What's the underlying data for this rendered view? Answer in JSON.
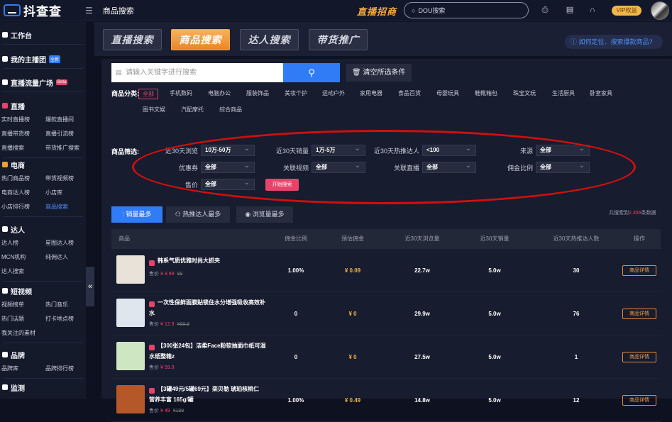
{
  "app": {
    "logo_text": "抖查查",
    "page_title": "商品搜索",
    "promo": "直播招商",
    "search_placeholder": "DOU搜索",
    "vip": "VIP权益"
  },
  "sidebar": [
    {
      "title": "工作台",
      "icon": "grid-icon",
      "items": []
    },
    {
      "title": "我的主播团",
      "badge": "全新",
      "icon": "team-icon",
      "items": []
    },
    {
      "title": "直播流量广场",
      "badge": "Beta",
      "icon": "broadcast-icon",
      "items": []
    },
    {
      "title": "直播",
      "icon": "chart-icon",
      "items": [
        "实时直播榜",
        "爆款直播间",
        "直播带货榜",
        "直播引流榜",
        "直播搜索",
        "带货推广搜索"
      ]
    },
    {
      "title": "电商",
      "icon": "shop-icon",
      "items": [
        "热门商品榜",
        "带货视频榜",
        "电商达人榜",
        "小店库",
        "小店排行榜",
        "商品搜索"
      ]
    },
    {
      "title": "达人",
      "icon": "person-icon",
      "items": [
        "达人榜",
        "星图达人榜",
        "MCN机构",
        "纯佣达人",
        "达人搜索"
      ]
    },
    {
      "title": "短视频",
      "icon": "bulb-icon",
      "items": [
        "视频榜单",
        "热门音乐",
        "热门话题",
        "打卡地点榜",
        "我关注的素材"
      ]
    },
    {
      "title": "品牌",
      "icon": "brand-icon",
      "items": [
        "品牌库",
        "品牌排行榜"
      ]
    },
    {
      "title": "监测",
      "icon": "monitor-icon",
      "items": []
    }
  ],
  "active_sidebar_item": "商品搜索",
  "tabs": [
    "直播搜索",
    "商品搜索",
    "达人搜索",
    "带货推广"
  ],
  "help_link": "如何定位、搜索爆款商品?",
  "keyword_placeholder": "请输入关键字进行搜索",
  "clear_label": "清空所选条件",
  "category_label": "商品分类:",
  "categories": [
    "全部",
    "手机数码",
    "电脑办公",
    "服装饰品",
    "美妆个护",
    "运动户外",
    "家用电器",
    "食品百货",
    "母婴玩具",
    "鞋靴箱包",
    "珠宝文玩",
    "生活厨具",
    "卧室家具",
    "图书文娱",
    "汽配摩托",
    "综合商品"
  ],
  "filter_label": "商品筛选:",
  "filters": [
    {
      "label": "近30天浏览",
      "value": "10万-50万"
    },
    {
      "label": "近30天销量",
      "value": "1万-5万"
    },
    {
      "label": "近30天热推达人",
      "value": "<100"
    },
    {
      "label": "来源",
      "value": "全部"
    },
    {
      "label": "优惠券",
      "value": "全部"
    },
    {
      "label": "关联视频",
      "value": "全部"
    },
    {
      "label": "关联直播",
      "value": "全部"
    },
    {
      "label": "佣金比例",
      "value": "全部"
    },
    {
      "label": "售价",
      "value": "全部"
    }
  ],
  "start_button": "开始搜索",
  "sort_buttons": [
    "销量最多",
    "热推达人最多",
    "浏览量最多"
  ],
  "total": {
    "prefix": "共搜索到",
    "count": "2,356",
    "suffix": "条数据"
  },
  "columns": [
    "商品",
    "佣金比例",
    "预估佣金",
    "近30天浏览量",
    "近30天销量",
    "近30天热推达人数",
    "操作"
  ],
  "rows": [
    {
      "title": "韩系气质优雅时尚大抓夹",
      "price_label": "售价",
      "price": "¥ 8.99",
      "original": "¥9",
      "commission_rate": "1.00%",
      "commission": "¥ 0.09",
      "views": "22.7w",
      "sales": "5.0w",
      "influencers": "30",
      "action": "商品详情",
      "thumb_color": "#e8e2d8"
    },
    {
      "title": "一次性保鲜面膜贴锁住水分增强吸收高效补水",
      "price_label": "售价",
      "price": "¥ 12.9",
      "original": "¥69.9",
      "commission_rate": "0",
      "commission": "¥ 0",
      "views": "29.9w",
      "sales": "5.0w",
      "influencers": "76",
      "action": "商品详情",
      "thumb_color": "#dfe6ee"
    },
    {
      "title": "【300张24包】洁柔Face粉软抽面巾纸可湿水纸整箱z",
      "price_label": "售价",
      "price": "¥ 59.9",
      "original": "",
      "commission_rate": "0",
      "commission": "¥ 0",
      "views": "27.5w",
      "sales": "5.0w",
      "influencers": "1",
      "action": "商品详情",
      "thumb_color": "#cfe6c2"
    },
    {
      "title": "【3罐49元/5罐69元】栾贝勒 琥珀核桃仁 营养丰富 165g/罐",
      "price_label": "售价",
      "price": "¥ 49",
      "original": "¥199",
      "commission_rate": "1.00%",
      "commission": "¥ 0.49",
      "views": "14.8w",
      "sales": "5.0w",
      "influencers": "12",
      "action": "商品详情",
      "thumb_color": "#b4582a"
    }
  ]
}
